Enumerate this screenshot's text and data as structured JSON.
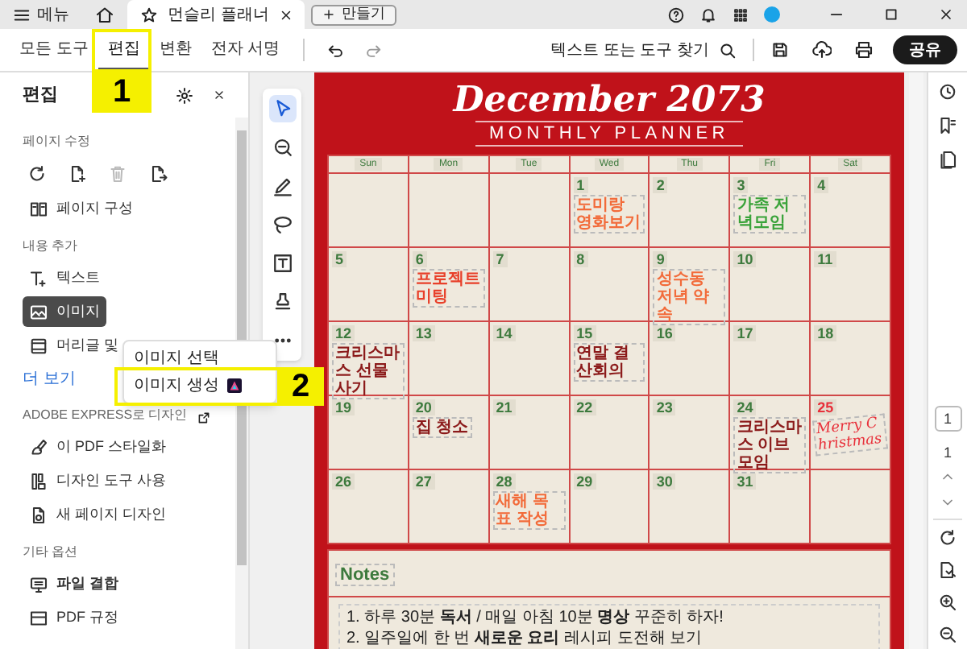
{
  "title_bar": {
    "menu_label": "메뉴",
    "tab_title": "먼슬리 플래너",
    "new_button": "만들기"
  },
  "toolbar": {
    "tabs": [
      {
        "label": "모든 도구",
        "selected": false
      },
      {
        "label": "편집",
        "selected": true
      },
      {
        "label": "변환",
        "selected": false
      },
      {
        "label": "전자 서명",
        "selected": false
      }
    ],
    "search_label": "텍스트 또는 도구 찾기",
    "share_button": "공유"
  },
  "edit_panel": {
    "title": "편집",
    "sections": [
      {
        "heading": "페이지 수정",
        "external": false,
        "icon_tools": [
          {
            "kind": "rotate",
            "disabled": false
          },
          {
            "kind": "insert",
            "disabled": false
          },
          {
            "kind": "delete",
            "disabled": true
          },
          {
            "kind": "extract",
            "disabled": false
          }
        ],
        "items": [
          {
            "label": "페이지 구성",
            "kind": "organize",
            "selected": false
          }
        ]
      },
      {
        "heading": "내용 추가",
        "external": false,
        "items": [
          {
            "label": "텍스트",
            "kind": "text",
            "selected": false
          },
          {
            "label": "이미지",
            "kind": "image",
            "selected": true
          },
          {
            "label": "머리글 및",
            "kind": "header",
            "selected": false
          }
        ],
        "link": "더 보기"
      },
      {
        "heading": "ADOBE EXPRESS로 디자인",
        "external": true,
        "items": [
          {
            "label": "이 PDF 스타일화",
            "kind": "style",
            "selected": false
          },
          {
            "label": "디자인 도구 사용",
            "kind": "design",
            "selected": false
          },
          {
            "label": "새 페이지 디자인",
            "kind": "newpage",
            "selected": false
          }
        ]
      },
      {
        "heading": "기타 옵션",
        "external": false,
        "items": [
          {
            "label": "파일 결합",
            "kind": "combine",
            "selected": false
          },
          {
            "label": "PDF 규정",
            "kind": "standard",
            "selected": false
          }
        ]
      }
    ]
  },
  "image_menu": {
    "items": [
      {
        "label": "이미지 선택",
        "kind": "plain"
      },
      {
        "label": "이미지 생성",
        "kind": "generate"
      }
    ]
  },
  "callouts": [
    {
      "number": "1"
    },
    {
      "number": "2"
    }
  ],
  "tool_strip": {
    "tools": [
      {
        "kind": "select",
        "selected": true
      },
      {
        "kind": "comment",
        "selected": false
      },
      {
        "kind": "draw",
        "selected": false
      },
      {
        "kind": "lasso",
        "selected": false
      },
      {
        "kind": "textbox",
        "selected": false
      },
      {
        "kind": "stamp",
        "selected": false
      },
      {
        "kind": "more",
        "selected": false
      }
    ]
  },
  "planner": {
    "title": "December 2073",
    "subtitle": "MONTHLY PLANNER",
    "weekdays": [
      "Sun",
      "Mon",
      "Tue",
      "Wed",
      "Thu",
      "Fri",
      "Sat"
    ],
    "weeks": [
      [
        {
          "kind": "blank"
        },
        {
          "kind": "blank"
        },
        {
          "kind": "blank"
        },
        {
          "day": "1",
          "holiday": false,
          "event": {
            "text": "도미랑 영화보기",
            "color": "#f26b3a",
            "kind": "note"
          }
        },
        {
          "day": "2",
          "holiday": false
        },
        {
          "day": "3",
          "holiday": false,
          "event": {
            "text": "가족 저녁모임",
            "color": "#3aa33a",
            "kind": "note"
          }
        },
        {
          "day": "4",
          "holiday": false
        }
      ],
      [
        {
          "day": "5",
          "holiday": false
        },
        {
          "day": "6",
          "holiday": false,
          "event": {
            "text": "프로젝트 미팅",
            "color": "#e8402a",
            "kind": "note"
          }
        },
        {
          "day": "7",
          "holiday": false
        },
        {
          "day": "8",
          "holiday": false
        },
        {
          "day": "9",
          "holiday": false,
          "event": {
            "text": "성수동 저녁 약속",
            "color": "#f26b3a",
            "kind": "note"
          }
        },
        {
          "day": "10",
          "holiday": false
        },
        {
          "day": "11",
          "holiday": false
        }
      ],
      [
        {
          "day": "12",
          "holiday": false,
          "event": {
            "text": "크리스마스 선물사기",
            "color": "#8b1a1a",
            "kind": "note"
          }
        },
        {
          "day": "13",
          "holiday": false
        },
        {
          "day": "14",
          "holiday": false
        },
        {
          "day": "15",
          "holiday": false,
          "event": {
            "text": "연말 결산회의",
            "color": "#8b1a1a",
            "kind": "note"
          }
        },
        {
          "day": "16",
          "holiday": false
        },
        {
          "day": "17",
          "holiday": false
        },
        {
          "day": "18",
          "holiday": false
        }
      ],
      [
        {
          "day": "19",
          "holiday": false
        },
        {
          "day": "20",
          "holiday": false,
          "event": {
            "text": "집 청소",
            "color": "#8b1a1a",
            "kind": "note"
          }
        },
        {
          "day": "21",
          "holiday": false
        },
        {
          "day": "22",
          "holiday": false
        },
        {
          "day": "23",
          "holiday": false
        },
        {
          "day": "24",
          "holiday": false,
          "event": {
            "text": "크리스마스 이브 모임",
            "color": "#8b1a1a",
            "kind": "note"
          }
        },
        {
          "day": "25",
          "holiday": true,
          "event": {
            "text": "Merry Christmas",
            "color": "#e8303a",
            "kind": "script"
          }
        }
      ],
      [
        {
          "day": "26",
          "holiday": false
        },
        {
          "day": "27",
          "holiday": false
        },
        {
          "day": "28",
          "holiday": false,
          "event": {
            "text": "새해 목표 작성",
            "color": "#f26b3a",
            "kind": "note"
          }
        },
        {
          "day": "29",
          "holiday": false
        },
        {
          "day": "30",
          "holiday": false
        },
        {
          "day": "31",
          "holiday": false
        },
        {
          "kind": "blank"
        }
      ]
    ],
    "notes_title": "Notes",
    "notes": [
      "1. 하루 30분 **독서** / 매일 아침 10분 **명상** 꾸준히 하자!",
      "2. 일주일에 한 번 **새로운 요리** 레시피 도전해 보기"
    ]
  },
  "right_rail": {
    "page_input": "1",
    "page_total": "1"
  }
}
